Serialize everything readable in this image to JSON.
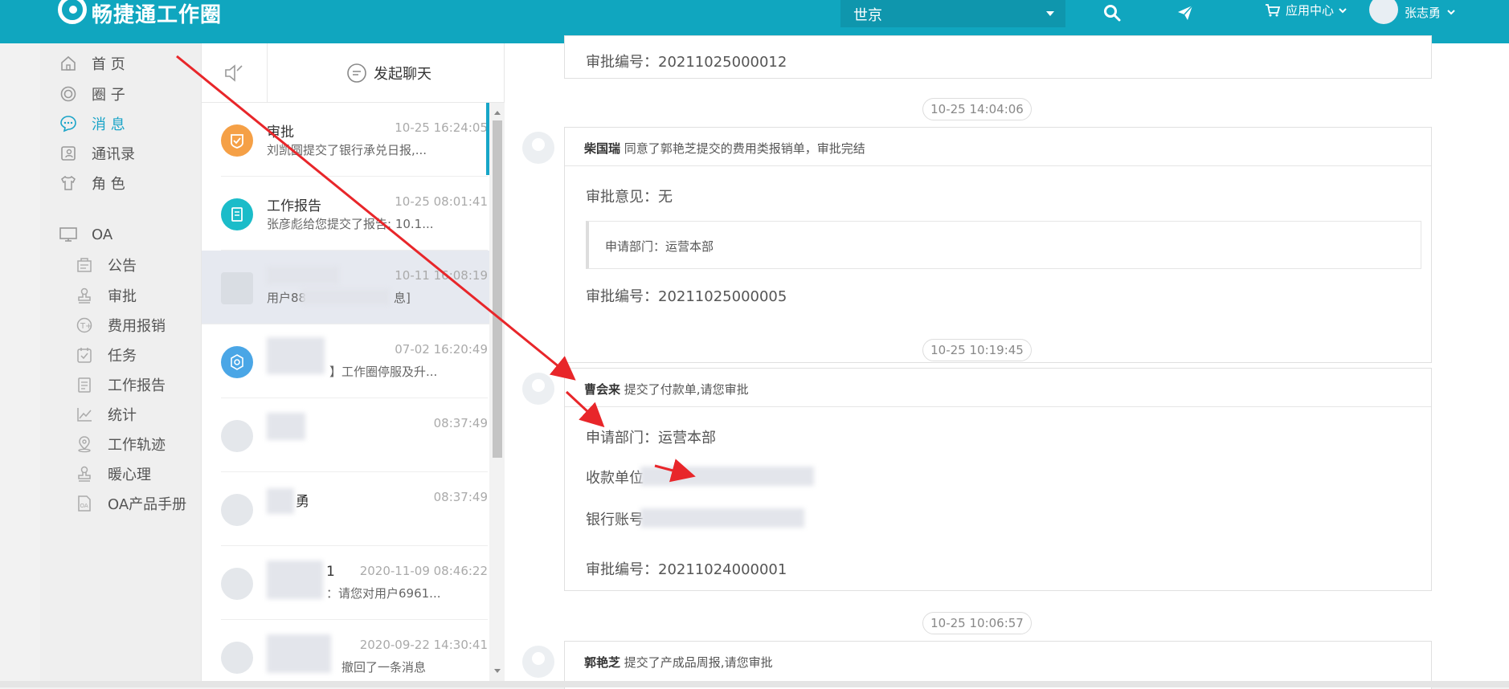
{
  "app": {
    "logo_text": "畅捷通工作圈"
  },
  "header": {
    "city": "世京",
    "app_center": "应用中心",
    "user_name": "张志勇"
  },
  "nav": {
    "items": [
      {
        "label": "首 页",
        "icon": "home-icon"
      },
      {
        "label": "圈 子",
        "icon": "circle-icon"
      },
      {
        "label": "消 息",
        "icon": "chat-bubble-icon",
        "active": true
      },
      {
        "label": "通讯录",
        "icon": "contacts-icon"
      },
      {
        "label": "角 色",
        "icon": "tshirt-icon"
      }
    ],
    "oa_label": "OA",
    "oa_items": [
      {
        "label": "公告",
        "icon": "announcement-icon"
      },
      {
        "label": "审批",
        "icon": "stamp-icon"
      },
      {
        "label": "费用报销",
        "icon": "expense-icon"
      },
      {
        "label": "任务",
        "icon": "task-icon"
      },
      {
        "label": "工作报告",
        "icon": "report-icon"
      },
      {
        "label": "统计",
        "icon": "chart-icon"
      },
      {
        "label": "工作轨迹",
        "icon": "location-icon"
      },
      {
        "label": "暖心理",
        "icon": "stamp2-icon"
      },
      {
        "label": "OA产品手册",
        "icon": "oa-manual-icon"
      }
    ]
  },
  "conversations": {
    "start_chat": "发起聊天",
    "items": [
      {
        "name": "审批",
        "time": "10-25 16:24:05",
        "msg": "刘凯圆提交了银行承兑日报,...",
        "avatar_color": "#f5a046"
      },
      {
        "name": "工作报告",
        "time": "10-25 08:01:41",
        "msg": "张彦彪给您提交了报告: 10.1...",
        "avatar_color": "#1bbcc9"
      },
      {
        "name": "",
        "time": "10-11 16:08:19",
        "msg": "用户88",
        "msg_tail": "息]",
        "selected": true
      },
      {
        "name": "",
        "time": "07-02 16:20:49",
        "msg": "】工作圈停服及升...",
        "avatar_color": "#4aa6e6"
      },
      {
        "name": "",
        "time": "08:37:49",
        "msg": ""
      },
      {
        "name": "勇",
        "time": "08:37:49",
        "msg": ""
      },
      {
        "name": "1",
        "time": "2020-11-09 08:46:22",
        "msg": "：请您对用户6961..."
      },
      {
        "name": "",
        "time": "2020-09-22 14:30:41",
        "msg": "撤回了一条消息"
      }
    ]
  },
  "chat": {
    "card0": {
      "row": "审批编号：20211025000012"
    },
    "time1": "10-25 14:04:06",
    "card1": {
      "author": "柴国瑞",
      "action": "同意了郭艳芝提交的费用类报销单，审批完结",
      "opinion": "审批意见：无",
      "quote": "申请部门：运营本部",
      "number": "审批编号：20211025000005"
    },
    "time2": "10-25 10:19:45",
    "card2": {
      "author": "曹会来",
      "action": "提交了付款单,请您审批",
      "dept": "申请部门：运营本部",
      "payee": "收款单位",
      "account": "银行账号",
      "number": "审批编号：20211024000001"
    },
    "time3": "10-25 10:06:57",
    "card3": {
      "author": "郭艳芝",
      "action": "提交了产成品周报,请您审批"
    }
  },
  "colors": {
    "brand": "#10a6bf",
    "accent": "#1aa4c8",
    "arrow": "#e8262a"
  }
}
